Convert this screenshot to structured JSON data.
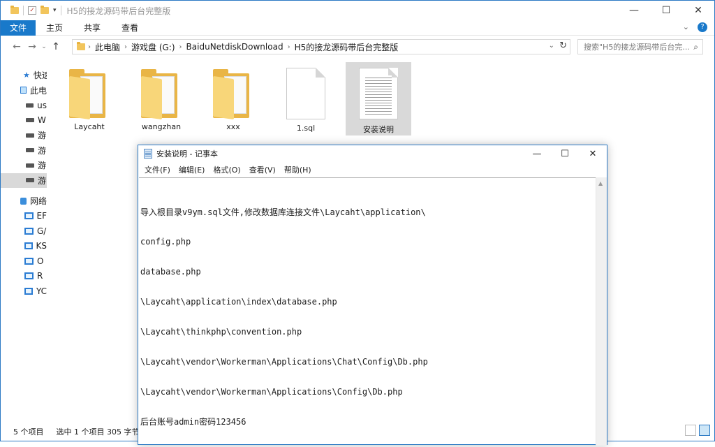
{
  "window": {
    "title": "H5的接龙源码带后台完整版",
    "minimize": "—",
    "maximize": "☐",
    "close": "✕"
  },
  "ribbon": {
    "tabs": [
      "文件",
      "主页",
      "共享",
      "查看"
    ],
    "expand": "⌄",
    "help": "?"
  },
  "addressbar": {
    "crumbs": [
      "此电脑",
      "游戏盘 (G:)",
      "BaiduNetdiskDownload",
      "H5的接龙源码带后台完整版"
    ],
    "search_placeholder": "搜索\"H5的接龙源码带后台完..."
  },
  "navpane": {
    "items": [
      {
        "label": "快速",
        "icon": "star-icon"
      },
      {
        "label": "此电",
        "icon": "pc-icon"
      },
      {
        "label": "us",
        "icon": "drive-icon"
      },
      {
        "label": "W",
        "icon": "drive-icon"
      },
      {
        "label": "游",
        "icon": "drive-icon"
      },
      {
        "label": "游",
        "icon": "drive-icon"
      },
      {
        "label": "游",
        "icon": "drive-icon"
      },
      {
        "label": "游",
        "icon": "drive-icon"
      },
      {
        "label": "网络",
        "icon": "network-icon"
      },
      {
        "label": "EF",
        "icon": "monitor-icon"
      },
      {
        "label": "G/",
        "icon": "monitor-icon"
      },
      {
        "label": "KS",
        "icon": "monitor-icon"
      },
      {
        "label": "O",
        "icon": "monitor-icon"
      },
      {
        "label": "R",
        "icon": "monitor-icon"
      },
      {
        "label": "YC",
        "icon": "monitor-icon"
      }
    ]
  },
  "files": [
    {
      "name": "Laycaht",
      "type": "folder"
    },
    {
      "name": "wangzhan",
      "type": "folder"
    },
    {
      "name": "xxx",
      "type": "folder"
    },
    {
      "name": "1.sql",
      "type": "file"
    },
    {
      "name": "安装说明",
      "type": "text",
      "selected": true
    }
  ],
  "statusbar": {
    "count": "5 个项目",
    "selection": "选中 1 个项目  305 字节"
  },
  "notepad": {
    "title": "安装说明 - 记事本",
    "menu": [
      "文件(F)",
      "编辑(E)",
      "格式(O)",
      "查看(V)",
      "帮助(H)"
    ],
    "lines": [
      "导入根目录v9ym.sql文件,修改数据库连接文件\\Laycaht\\application\\",
      "config.php",
      "database.php",
      "\\Laycaht\\application\\index\\database.php",
      "\\Laycaht\\thinkphp\\convention.php",
      "\\Laycaht\\vendor\\Workerman\\Applications\\Chat\\Config\\Db.php",
      "\\Laycaht\\vendor\\Workerman\\Applications\\Config\\Db.php",
      "后台账号admin密码123456"
    ]
  }
}
